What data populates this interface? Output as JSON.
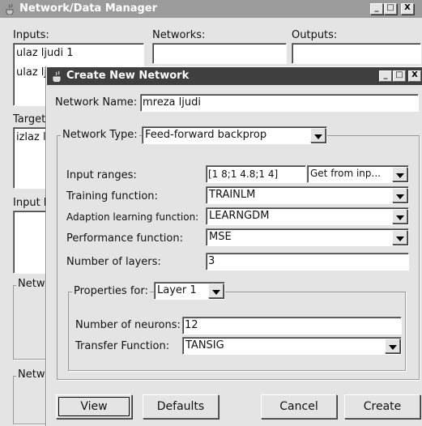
{
  "bg_window": {
    "title": "Network/Data Manager",
    "inputs_label": "Inputs:",
    "networks_label": "Networks:",
    "outputs_label": "Outputs:",
    "inputs_list": [
      "ulaz ljudi 1",
      "ulaz lj"
    ],
    "targets_label": "Target",
    "targets_list": [
      "izlaz l"
    ],
    "input_delay_label": "Input D",
    "network_group_1": "Netw",
    "network_group_2": "Netw"
  },
  "dialog": {
    "title": "Create New Network",
    "network_name_label": "Network Name:",
    "network_name_value": "mreza ljudi",
    "network_type_label": "Network Type:",
    "network_type_value": "Feed-forward backprop",
    "input_ranges_label": "Input ranges:",
    "input_ranges_value": "[1 8;1 4.8;1 4]",
    "get_from_input_value": "Get from inp...",
    "training_function_label": "Training function:",
    "training_function_value": "TRAINLM",
    "adaption_function_label": "Adaption learning function:",
    "adaption_function_value": "LEARNGDM",
    "performance_function_label": "Performance function:",
    "performance_function_value": "MSE",
    "num_layers_label": "Number of layers:",
    "num_layers_value": "3",
    "properties_for_label": "Properties for:",
    "properties_for_value": "Layer 1",
    "num_neurons_label": "Number of neurons:",
    "num_neurons_value": "12",
    "transfer_function_label": "Transfer Function:",
    "transfer_function_value": "TANSIG",
    "buttons": {
      "view": "View",
      "defaults": "Defaults",
      "cancel": "Cancel",
      "create": "Create"
    }
  },
  "window_controls": {
    "minimize": "_",
    "maximize": "□",
    "close": "X"
  },
  "colors": {
    "titlebar_inactive": "#9a9a9a",
    "titlebar_active": "#3e3e3e",
    "background": "#e4e4e4"
  }
}
